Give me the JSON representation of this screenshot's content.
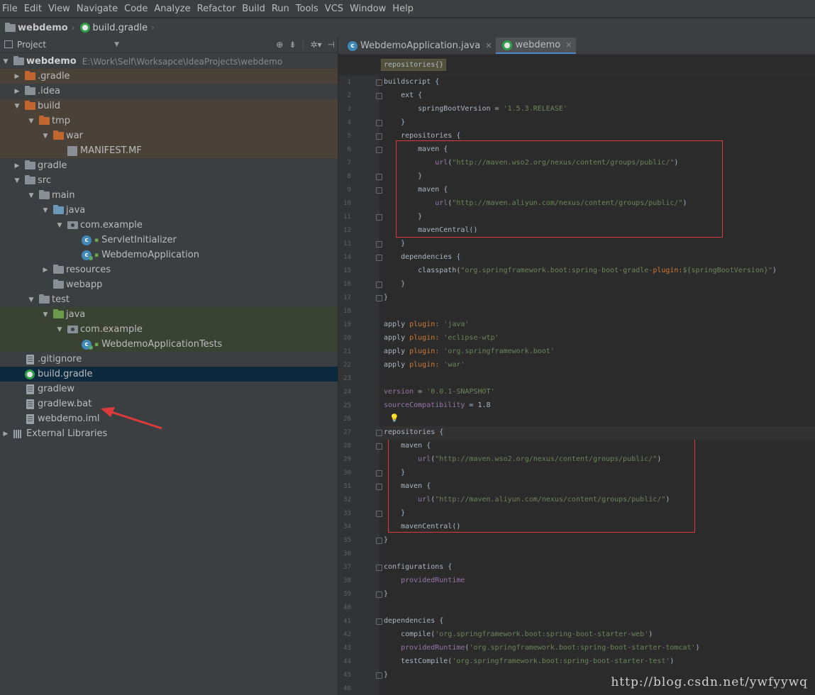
{
  "menu": [
    "File",
    "Edit",
    "View",
    "Navigate",
    "Code",
    "Analyze",
    "Refactor",
    "Build",
    "Run",
    "Tools",
    "VCS",
    "Window",
    "Help"
  ],
  "breadcrumb": [
    "webdemo",
    "build.gradle"
  ],
  "project_panel": {
    "title": "Project",
    "tree": [
      {
        "label": "webdemo",
        "path": "E:\\Work\\Self\\Worksapce\\IdeaProjects\\webdemo",
        "depth": 0,
        "arrow": "down",
        "icon": "folder-grey",
        "bold": true
      },
      {
        "label": ".gradle",
        "depth": 1,
        "arrow": "right",
        "icon": "folder-orange",
        "bg": "brown"
      },
      {
        "label": ".idea",
        "depth": 1,
        "arrow": "right",
        "icon": "folder-grey"
      },
      {
        "label": "build",
        "depth": 1,
        "arrow": "down",
        "icon": "folder-orange",
        "bg": "brown"
      },
      {
        "label": "tmp",
        "depth": 2,
        "arrow": "down",
        "icon": "folder-orange",
        "bg": "brown"
      },
      {
        "label": "war",
        "depth": 3,
        "arrow": "down",
        "icon": "folder-orange",
        "bg": "brown"
      },
      {
        "label": "MANIFEST.MF",
        "depth": 4,
        "arrow": "none",
        "icon": "manifest",
        "bg": "brown"
      },
      {
        "label": "gradle",
        "depth": 1,
        "arrow": "right",
        "icon": "folder-grey"
      },
      {
        "label": "src",
        "depth": 1,
        "arrow": "down",
        "icon": "folder-grey"
      },
      {
        "label": "main",
        "depth": 2,
        "arrow": "down",
        "icon": "folder-grey"
      },
      {
        "label": "java",
        "depth": 3,
        "arrow": "down",
        "icon": "folder-blue"
      },
      {
        "label": "com.example",
        "depth": 4,
        "arrow": "down",
        "icon": "package"
      },
      {
        "label": "ServletInitializer",
        "depth": 5,
        "arrow": "none",
        "icon": "class"
      },
      {
        "label": "WebdemoApplication",
        "depth": 5,
        "arrow": "none",
        "icon": "class-run"
      },
      {
        "label": "resources",
        "depth": 3,
        "arrow": "right",
        "icon": "folder-grey"
      },
      {
        "label": "webapp",
        "depth": 3,
        "arrow": "none",
        "icon": "folder-grey"
      },
      {
        "label": "test",
        "depth": 2,
        "arrow": "down",
        "icon": "folder-grey"
      },
      {
        "label": "java",
        "depth": 3,
        "arrow": "down",
        "icon": "folder-green",
        "bg": "green"
      },
      {
        "label": "com.example",
        "depth": 4,
        "arrow": "down",
        "icon": "package",
        "bg": "green"
      },
      {
        "label": "WebdemoApplicationTests",
        "depth": 5,
        "arrow": "none",
        "icon": "class-run",
        "bg": "green"
      },
      {
        "label": ".gitignore",
        "depth": 1,
        "arrow": "none",
        "icon": "file"
      },
      {
        "label": "build.gradle",
        "depth": 1,
        "arrow": "none",
        "icon": "gradle",
        "bg": "sel"
      },
      {
        "label": "gradlew",
        "depth": 1,
        "arrow": "none",
        "icon": "file"
      },
      {
        "label": "gradlew.bat",
        "depth": 1,
        "arrow": "none",
        "icon": "file"
      },
      {
        "label": "webdemo.iml",
        "depth": 1,
        "arrow": "none",
        "icon": "file"
      },
      {
        "label": "External Libraries",
        "depth": 0,
        "arrow": "right",
        "icon": "libraries"
      }
    ]
  },
  "editor": {
    "tabs": [
      {
        "label": "WebdemoApplication.java",
        "icon": "class-icon",
        "active": false
      },
      {
        "label": "webdemo",
        "icon": "gradle-icon",
        "active": true
      }
    ],
    "breadcrumb_tag": "repositories{}",
    "lines": [
      "buildscript {",
      "    ext {",
      "        springBootVersion = '1.5.3.RELEASE'",
      "    }",
      "    repositories {",
      "        maven {",
      "            url(\"http://maven.wso2.org/nexus/content/groups/public/\")",
      "        }",
      "        maven {",
      "            url(\"http://maven.aliyun.com/nexus/content/groups/public/\")",
      "        }",
      "        mavenCentral()",
      "    }",
      "    dependencies {",
      "        classpath(\"org.springframework.boot:spring-boot-gradle-plugin:${springBootVersion}\")",
      "    }",
      "}",
      "",
      "apply plugin: 'java'",
      "apply plugin: 'eclipse-wtp'",
      "apply plugin: 'org.springframework.boot'",
      "apply plugin: 'war'",
      "",
      "version = '0.0.1-SNAPSHOT'",
      "sourceCompatibility = 1.8",
      "",
      "repositories {",
      "    maven {",
      "        url(\"http://maven.wso2.org/nexus/content/groups/public/\")",
      "    }",
      "    maven {",
      "        url(\"http://maven.aliyun.com/nexus/content/groups/public/\")",
      "    }",
      "    mavenCentral()",
      "}",
      "",
      "configurations {",
      "    providedRuntime",
      "}",
      "",
      "dependencies {",
      "    compile('org.springframework.boot:spring-boot-starter-web')",
      "    providedRuntime('org.springframework.boot:spring-boot-starter-tomcat')",
      "    testCompile('org.springframework.boot:spring-boot-starter-test')",
      "}",
      ""
    ]
  },
  "watermark": "http://blog.csdn.net/ywfyywq",
  "colors": {
    "annotation_red": "#e03b3b",
    "selection": "#0d293e",
    "keyword": "#cc7832",
    "string": "#6a8759",
    "property": "#9876aa"
  }
}
